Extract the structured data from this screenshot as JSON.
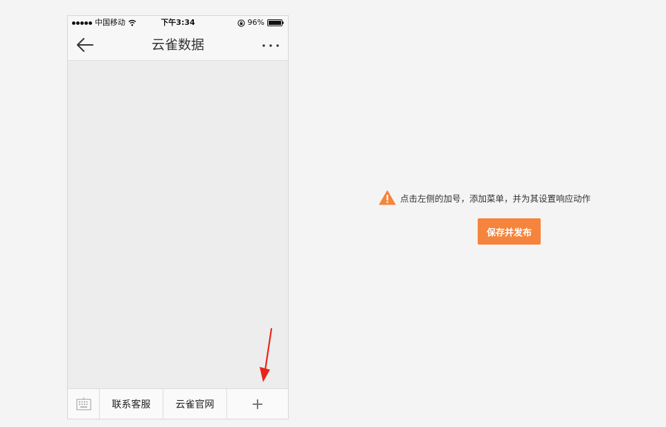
{
  "colors": {
    "accent": "#f5843c",
    "warning": "#f5843c",
    "annotation_arrow": "#e8241a",
    "background": "#f4f4f4",
    "phone_content": "#ededed"
  },
  "statusbar": {
    "carrier": "中国移动",
    "time": "下午3:34",
    "battery": "96%",
    "icons": [
      "signal-dots-icon",
      "wifi-icon",
      "rotation-lock-icon",
      "battery-icon"
    ]
  },
  "navbar": {
    "title": "云雀数据",
    "back_icon": "back-arrow-icon",
    "more_icon": "more-dots-icon"
  },
  "menubar": {
    "keyboard_icon": "keyboard-icon",
    "items": [
      {
        "label": "联系客服"
      },
      {
        "label": "云雀官网"
      }
    ],
    "add_icon": "plus-icon"
  },
  "hint": {
    "icon": "warning-icon",
    "text": "点击左侧的加号，添加菜单，并为其设置响应动作"
  },
  "actions": {
    "publish_label": "保存并发布"
  }
}
